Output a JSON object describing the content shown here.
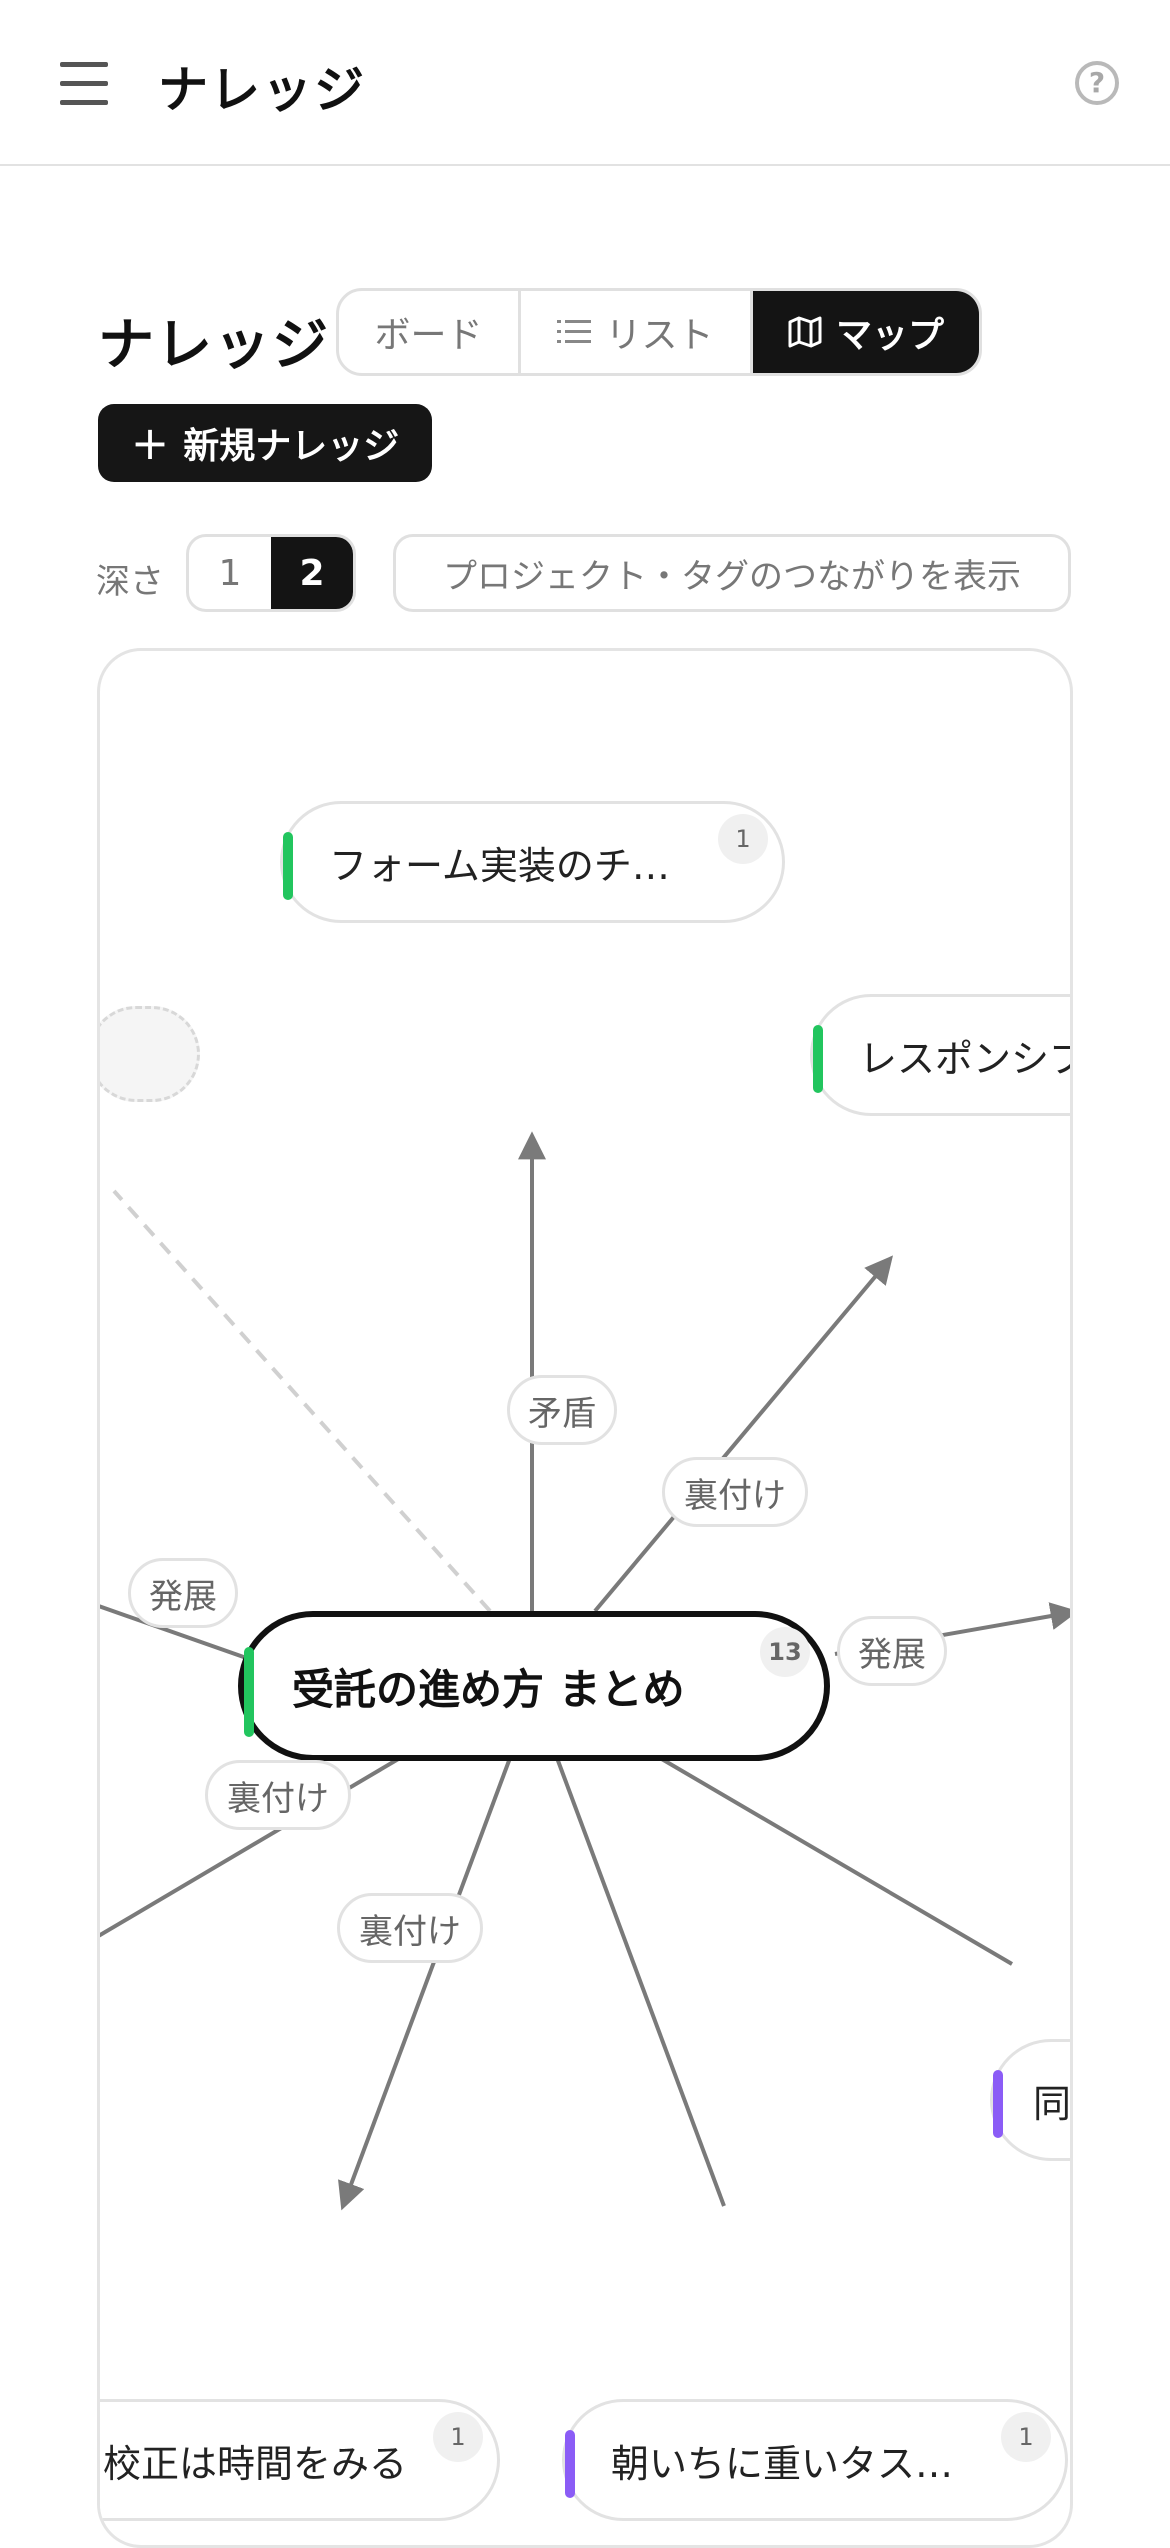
{
  "header": {
    "title": "ナレッジ",
    "menu_icon": "hamburger-menu-icon",
    "help_icon": "question-circle-icon",
    "help_glyph": "?"
  },
  "toolbar": {
    "page_title": "ナレッジ",
    "view_tabs": [
      {
        "label": "ボード",
        "icon": "",
        "selected": false
      },
      {
        "label": "リスト",
        "icon": "list-icon",
        "selected": false
      },
      {
        "label": "マップ",
        "icon": "map-icon",
        "selected": true
      }
    ],
    "new_button_label": "新規ナレッジ",
    "new_button_icon": "plus-icon",
    "depth_label": "深さ",
    "depth_options": [
      "1",
      "2"
    ],
    "depth_selected": "2",
    "connections_button_label": "プロジェクト・タグのつながりを表示"
  },
  "map": {
    "center_node": {
      "label": "受託の進め方 まとめ",
      "count": "13",
      "accent": "#22c55e"
    },
    "nodes": [
      {
        "label": "フォーム実装のチ…",
        "count": "1",
        "accent": "#22c55e"
      },
      {
        "label": "レスポンシブ",
        "count": "",
        "accent": "#22c55e"
      },
      {
        "label": "同",
        "count": "",
        "accent": "#8b5cf6"
      },
      {
        "label": "校正は時間をみる",
        "count": "1",
        "accent": ""
      },
      {
        "label": "朝いちに重いタス…",
        "count": "1",
        "accent": "#8b5cf6"
      }
    ],
    "edge_labels": [
      "矛盾",
      "裏付け",
      "発展",
      "発展",
      "裏付け",
      "裏付け"
    ]
  },
  "colors": {
    "accent_green": "#22c55e",
    "accent_purple": "#8b5cf6",
    "selected_dark": "#141414",
    "edge_gray": "#7a7a7a"
  }
}
